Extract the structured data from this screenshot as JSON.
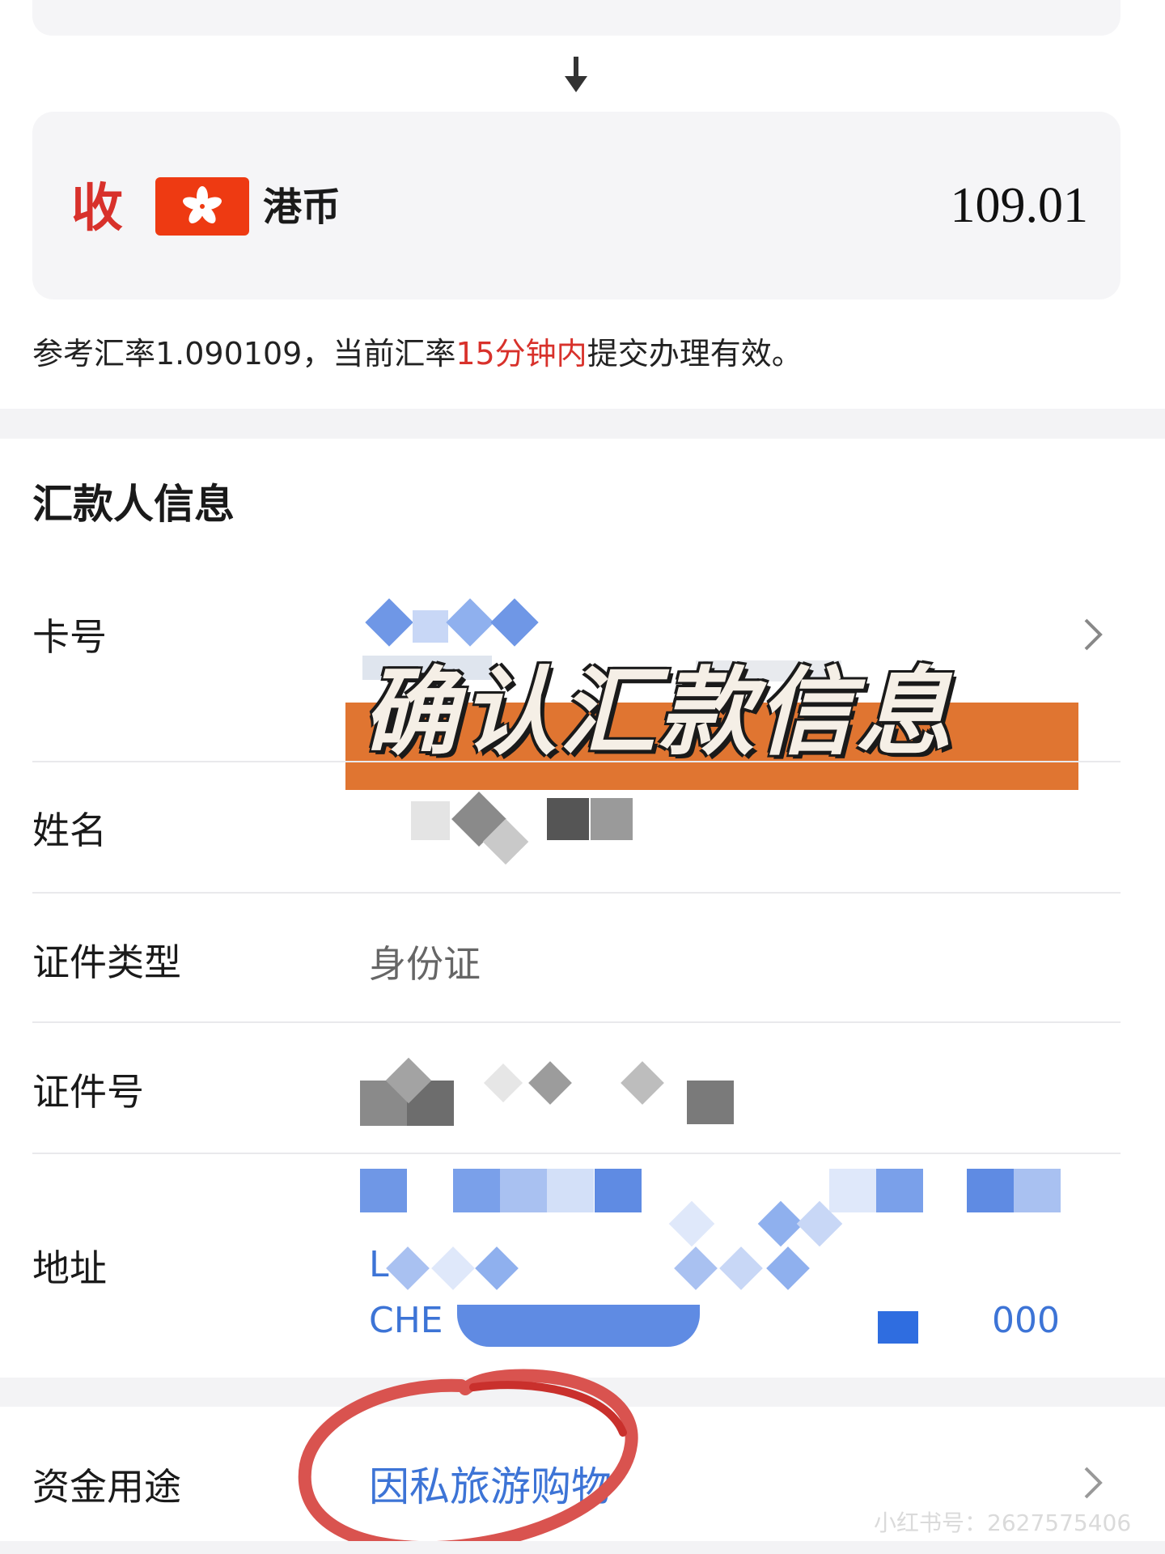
{
  "receive": {
    "label": "收",
    "currency": "港币",
    "amount": "109.01"
  },
  "rate_note": {
    "prefix": "参考汇率1.090109，当前汇率",
    "highlight": "15分钟内",
    "suffix": "提交办理有效。"
  },
  "sender_section": {
    "title": "汇款人信息",
    "rows": [
      {
        "label": "卡号"
      },
      {
        "label": "姓名"
      },
      {
        "label": "证件类型",
        "value": "身份证"
      },
      {
        "label": "证件号"
      },
      {
        "label": "地址",
        "value_lines": [
          "L",
          "CHE",
          "000"
        ]
      }
    ]
  },
  "banner": {
    "text": "确认汇款信息"
  },
  "purpose": {
    "label": "资金用途",
    "value": "因私旅游购物"
  },
  "watermark": "小红书号：2627575406",
  "colors": {
    "red": "#d8312b",
    "link_blue": "#3d74d6",
    "banner_orange": "#e07531",
    "card_bg": "#f5f5f7",
    "circle_red": "#d9534f"
  },
  "icons": [
    "arrow-down-icon",
    "hk-flag-icon",
    "chevron-right-icon"
  ]
}
